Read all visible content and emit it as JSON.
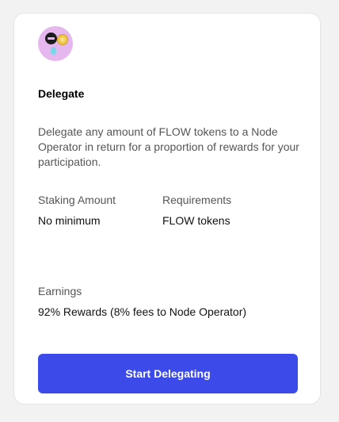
{
  "card": {
    "logo_icon": "flow-token-icon",
    "title": "Delegate",
    "description": "Delegate any amount of FLOW tokens to a Node Operator in return for a proportion of rewards for your participation.",
    "staking_amount": {
      "label": "Staking Amount",
      "value": "No minimum"
    },
    "requirements": {
      "label": "Requirements",
      "value": "FLOW tokens"
    },
    "earnings": {
      "label": "Earnings",
      "value": "92% Rewards (8% fees to Node Operator)"
    },
    "button_label": "Start Delegating"
  },
  "colors": {
    "accent": "#3b4ae8",
    "background": "#f2f2f2",
    "card": "#ffffff",
    "logo_background": "#e6b7ee"
  }
}
